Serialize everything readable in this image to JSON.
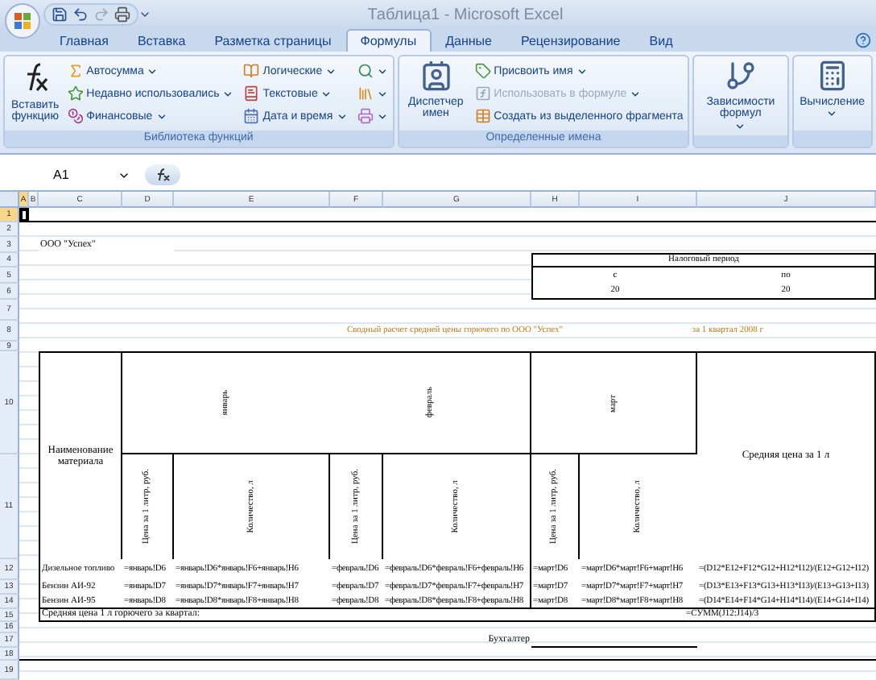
{
  "window": {
    "title": "Таблица1 - Microsoft Excel"
  },
  "tabs": [
    {
      "label": "Главная",
      "selected": false
    },
    {
      "label": "Вставка",
      "selected": false
    },
    {
      "label": "Разметка страницы",
      "selected": false
    },
    {
      "label": "Формулы",
      "selected": true
    },
    {
      "label": "Данные",
      "selected": false
    },
    {
      "label": "Рецензирование",
      "selected": false
    },
    {
      "label": "Вид",
      "selected": false
    }
  ],
  "ribbon": {
    "groups": [
      {
        "title": "Библиотека функций",
        "items": [
          {
            "kind": "large",
            "label": "Вставить функцию",
            "has_menu": false,
            "disabled": false
          },
          {
            "kind": "small",
            "label": "Автосумма",
            "has_menu": true,
            "disabled": false
          },
          {
            "kind": "small",
            "label": "Недавно использовались",
            "has_menu": true,
            "disabled": false
          },
          {
            "kind": "small",
            "label": "Финансовые",
            "has_menu": true,
            "disabled": false
          },
          {
            "kind": "small",
            "label": "Логические",
            "has_menu": true,
            "disabled": false
          },
          {
            "kind": "small",
            "label": "Текстовые",
            "has_menu": true,
            "disabled": false
          },
          {
            "kind": "small",
            "label": "Дата и время",
            "has_menu": true,
            "disabled": false
          },
          {
            "kind": "icon",
            "has_menu": true,
            "disabled": false
          },
          {
            "kind": "icon",
            "has_menu": true,
            "disabled": false
          },
          {
            "kind": "icon",
            "has_menu": true,
            "disabled": false
          }
        ]
      },
      {
        "title": "Определенные имена",
        "items": [
          {
            "kind": "large",
            "label": "Диспетчер имен",
            "has_menu": false,
            "disabled": false
          },
          {
            "kind": "small",
            "label": "Присвоить имя",
            "has_menu": true,
            "disabled": false
          },
          {
            "kind": "small",
            "label": "Использовать в формуле",
            "has_menu": true,
            "disabled": true
          },
          {
            "kind": "small",
            "label": "Создать из выделенного фрагмента",
            "has_menu": false,
            "disabled": false
          }
        ]
      },
      {
        "items": [
          {
            "kind": "large",
            "label": "Зависимости формул",
            "has_menu": true,
            "disabled": false
          }
        ]
      },
      {
        "items": [
          {
            "kind": "large",
            "label": "Вычисление",
            "has_menu": true,
            "disabled": false
          }
        ]
      }
    ]
  },
  "formula_bar": {
    "name_box": "A1"
  },
  "columns": [
    {
      "label": "A",
      "selected": true
    },
    {
      "label": "B",
      "selected": false
    },
    {
      "label": "C",
      "selected": false
    },
    {
      "label": "D",
      "selected": false
    },
    {
      "label": "E",
      "selected": false
    },
    {
      "label": "F",
      "selected": false
    },
    {
      "label": "G",
      "selected": false
    },
    {
      "label": "H",
      "selected": false
    },
    {
      "label": "I",
      "selected": false
    },
    {
      "label": "J",
      "selected": false
    }
  ],
  "rows": [
    {
      "label": "1",
      "selected": true
    },
    {
      "label": "2",
      "selected": false
    },
    {
      "label": "3",
      "selected": false
    },
    {
      "label": "4",
      "selected": false
    },
    {
      "label": "5",
      "selected": false
    },
    {
      "label": "6",
      "selected": false
    },
    {
      "label": "7",
      "selected": false
    },
    {
      "label": "8",
      "selected": false
    },
    {
      "label": "9",
      "selected": false
    },
    {
      "label": "10",
      "selected": false
    },
    {
      "label": "11",
      "selected": false
    },
    {
      "label": "12",
      "selected": false
    },
    {
      "label": "13",
      "selected": false
    },
    {
      "label": "14",
      "selected": false
    },
    {
      "label": "15",
      "selected": false
    },
    {
      "label": "16",
      "selected": false
    },
    {
      "label": "17",
      "selected": false
    },
    {
      "label": "18",
      "selected": false
    },
    {
      "label": "19",
      "selected": false
    }
  ],
  "sheet": {
    "company": "ООО \"Успех\"",
    "period": {
      "title": "Налоговый период",
      "from_label": "с",
      "to_label": "по",
      "from_year": "20",
      "to_year": "20"
    },
    "report_title": "Сводный расчет средней цены горючего по ООО \"Успех\"",
    "report_date": "за 1 квартал 2008 г",
    "table": {
      "name_header": "Наименование материала",
      "avg_header": "Средняя цена за 1 л",
      "months": [
        {
          "name": "январь",
          "price_header": "Цена за 1 литр, руб.",
          "qty_header": "Количество, л"
        },
        {
          "name": "февраль",
          "price_header": "Цена за 1 литр, руб.",
          "qty_header": "Количество, л"
        },
        {
          "name": "март",
          "price_header": "Цена за 1 литр, руб.",
          "qty_header": "Количество, л"
        }
      ],
      "rows": [
        {
          "name": "Дизельное топливо",
          "cells": [
            "=январь!D6",
            "=январь!D6*январь!F6+январь!H6",
            "=февраль!D6",
            "=февраль!D6*февраль!F6+февраль!H6",
            "=март!D6",
            "=март!D6*март!F6+март!H6"
          ],
          "avg": "=(D12*E12+F12*G12+H12*I12)/(E12+G12+I12)"
        },
        {
          "name": "Бензин АИ-92",
          "cells": [
            "=январь!D7",
            "=январь!D7*январь!F7+январь!H7",
            "=февраль!D7",
            "=февраль!D7*февраль!F7+февраль!H7",
            "=март!D7",
            "=март!D7*март!F7+март!H7"
          ],
          "avg": "=(D13*E13+F13*G13+H13*I13)/(E13+G13+I13)"
        },
        {
          "name": "Бензин АИ-95",
          "cells": [
            "=январь!D8",
            "=январь!D8*январь!F8+январь!H8",
            "=февраль!D8",
            "=февраль!D8*февраль!F8+февраль!H8",
            "=март!D8",
            "=март!D8*март!F8+март!H8"
          ],
          "avg": "=(D14*E14+F14*G14+H14*I14)/(E14+G14+I14)"
        }
      ],
      "total": {
        "label": "Средняя цена 1 л горючего за квартал:",
        "value": "=СУММ(J12:J14)/3"
      }
    },
    "signature": "Бухгалтер"
  }
}
